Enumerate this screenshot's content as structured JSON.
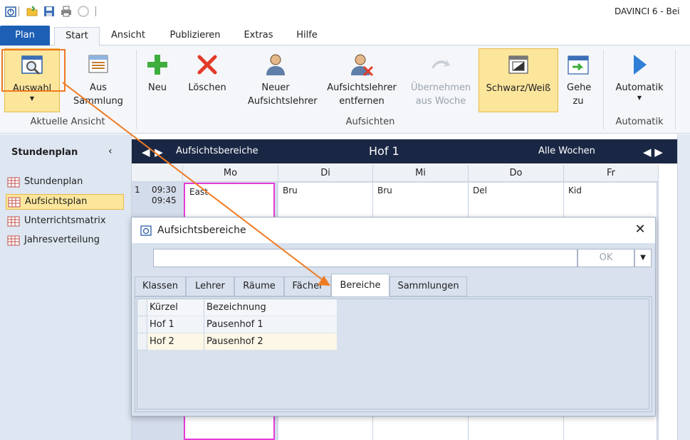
{
  "app": {
    "title": "DAVINCI 6 - Bei"
  },
  "ribbon_tabs": [
    "Plan",
    "Start",
    "Ansicht",
    "Publizieren",
    "Extras",
    "Hilfe"
  ],
  "ribbon": {
    "auswahl": "Auswahl",
    "aus_sammlung": "Aus Sammlung",
    "group_aktuelle_ansicht": "Aktuelle Ansicht",
    "neu": "Neu",
    "loeschen": "Löschen",
    "neuer_aufsichtslehrer": "Neuer Aufsichtslehrer",
    "aufsichtslehrer_entfernen": "Aufsichtslehrer entfernen",
    "uebernehmen_aus_woche": "Übernehmen aus Woche",
    "schwarz_weiss": "Schwarz/Weiß",
    "gehe_zu": "Gehe zu",
    "group_aufsichten": "Aufsichten",
    "automatik": "Automatik",
    "group_automatik": "Automatik"
  },
  "sidebar": {
    "title": "Stundenplan",
    "items": [
      "Stundenplan",
      "Aufsichtsplan",
      "Unterrichtsmatrix",
      "Jahresverteilung"
    ]
  },
  "timetable": {
    "area_label": "Aufsichtsbereiche",
    "title": "Hof 1",
    "weeks": "Alle Wochen",
    "days": [
      "Mo",
      "Di",
      "Mi",
      "Do",
      "Fr"
    ],
    "period": {
      "number": "1",
      "start": "09:30",
      "end": "09:45"
    },
    "entries": [
      "East",
      "Bru",
      "Bru",
      "Del",
      "Kid"
    ]
  },
  "dialog": {
    "title": "Aufsichtsbereiche",
    "input_value": "",
    "ok_label": "OK",
    "tabs": [
      "Klassen",
      "Lehrer",
      "Räume",
      "Fächer",
      "Bereiche",
      "Sammlungen"
    ],
    "columns": [
      "Kürzel",
      "Bezeichnung"
    ],
    "rows": [
      {
        "kuerzel": "Hof 1",
        "bezeichnung": "Pausenhof 1"
      },
      {
        "kuerzel": "Hof 2",
        "bezeichnung": "Pausenhof 2"
      }
    ]
  },
  "colors": {
    "accent": "#1c5fb5",
    "highlight": "#fbe69c",
    "annotation": "#f07a22",
    "dark_header": "#1a2744"
  }
}
